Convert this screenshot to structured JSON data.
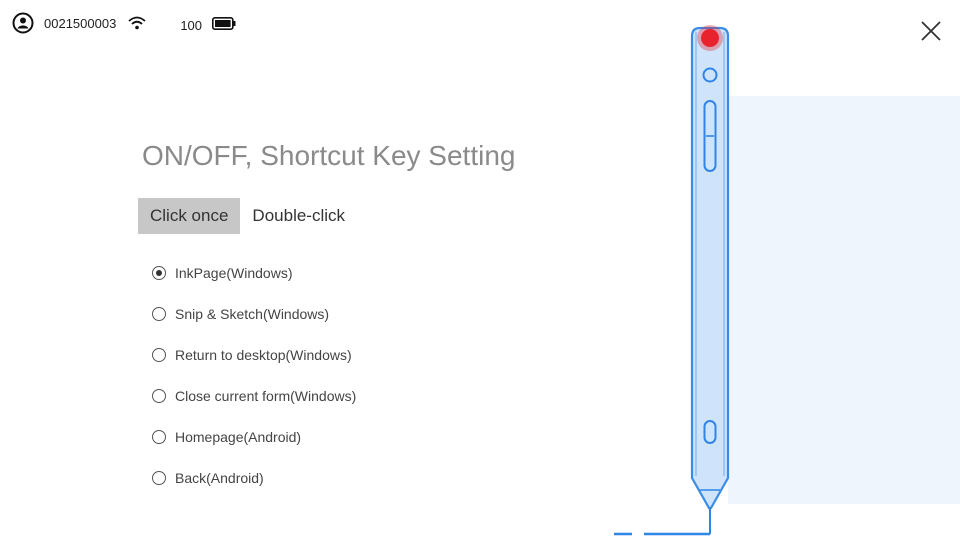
{
  "status": {
    "user_icon": "user-circle-icon",
    "device_id": "0021500003",
    "wifi_icon": "wifi-icon",
    "battery_level": "100",
    "battery_icon": "battery-icon"
  },
  "close_icon": "close-icon",
  "title": "ON/OFF, Shortcut Key Setting",
  "tabs": [
    {
      "label": "Click once",
      "active": true
    },
    {
      "label": "Double-click",
      "active": false
    }
  ],
  "options": [
    {
      "label": "InkPage(Windows)",
      "checked": true
    },
    {
      "label": "Snip & Sketch(Windows)",
      "checked": false
    },
    {
      "label": "Return to desktop(Windows)",
      "checked": false
    },
    {
      "label": "Close current form(Windows)",
      "checked": false
    },
    {
      "label": "Homepage(Android)",
      "checked": false
    },
    {
      "label": "Back(Android)",
      "checked": false
    }
  ],
  "colors": {
    "pen_outline": "#2f86e6",
    "pen_fill": "#cde2fb",
    "highlight_dot": "#e8232e",
    "panel_bg": "#eef5fd",
    "active_tab_bg": "#c7c7c7"
  }
}
